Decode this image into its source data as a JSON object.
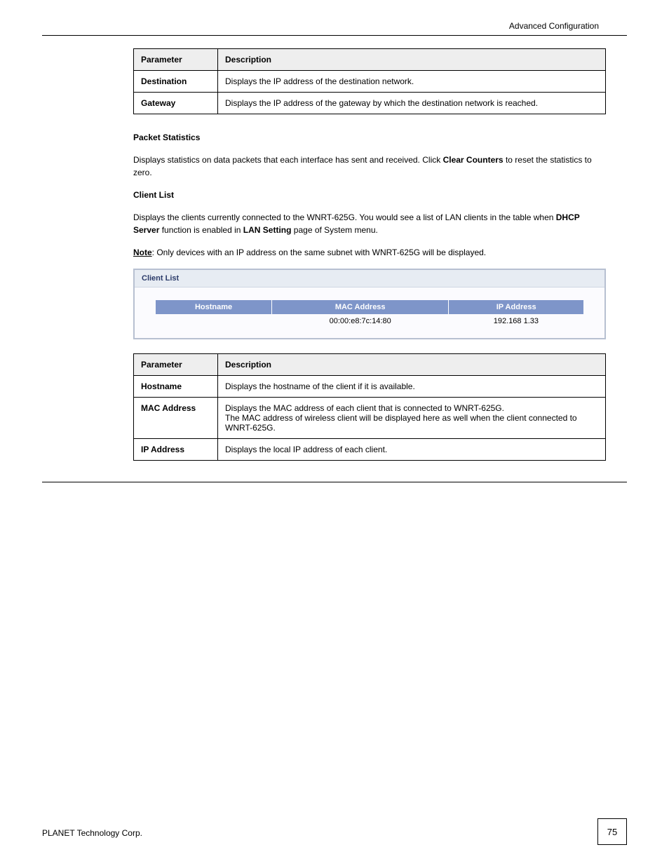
{
  "header": {
    "section": "Advanced Configuration"
  },
  "table1": {
    "head": {
      "param": "Parameter",
      "desc": "Description"
    },
    "rows": [
      {
        "label": "Destination",
        "desc": "Displays the IP address of the destination network."
      },
      {
        "label": "Gateway",
        "desc": "Displays the IP address of the gateway by which the destination network is reached."
      }
    ]
  },
  "pkt_title": "Packet Statistics",
  "pkt_intro": "Displays statistics on data packets that each interface has sent and received. ",
  "pkt_clear_sentence": {
    "prefix": "Click ",
    "strong": "Clear Counters",
    "suffix": " to reset the statistics to zero."
  },
  "cl_title": "Client List",
  "cl_intro_prefix": "Displays the clients currently connected to the WNRT-625G. You would see a list of LAN clients in the table when ",
  "cl_intro_strong": "DHCP Server",
  "cl_intro_mid": " function is enabled in ",
  "cl_intro_strong2": "LAN Setting",
  "cl_intro_suffix": " page of System menu.",
  "note": {
    "label": "Note",
    "text": ": Only devices with an IP address on the same subnet with WNRT-625G will be displayed."
  },
  "ui_shot": {
    "title": "Client List",
    "headers": [
      "Hostname",
      "MAC Address",
      "IP Address"
    ],
    "row": {
      "hostname": "",
      "mac": "00:00:e8:7c:14:80",
      "ip": "192.168 1.33"
    }
  },
  "table2": {
    "head": {
      "param": "Parameter",
      "desc": "Description"
    },
    "rows": [
      {
        "label": "Hostname",
        "desc": "Displays the hostname of the client if it is available."
      },
      {
        "label": "MAC Address",
        "desc_lines": [
          "Displays the MAC address of each client that is connected to WNRT-625G.",
          "The MAC address of wireless client will be displayed here as well when the client connected to WNRT-625G."
        ]
      },
      {
        "label": "IP Address",
        "desc": "Displays the local IP address of each client."
      }
    ]
  },
  "footer": {
    "left": "PLANET Technology Corp.",
    "page": "75"
  }
}
